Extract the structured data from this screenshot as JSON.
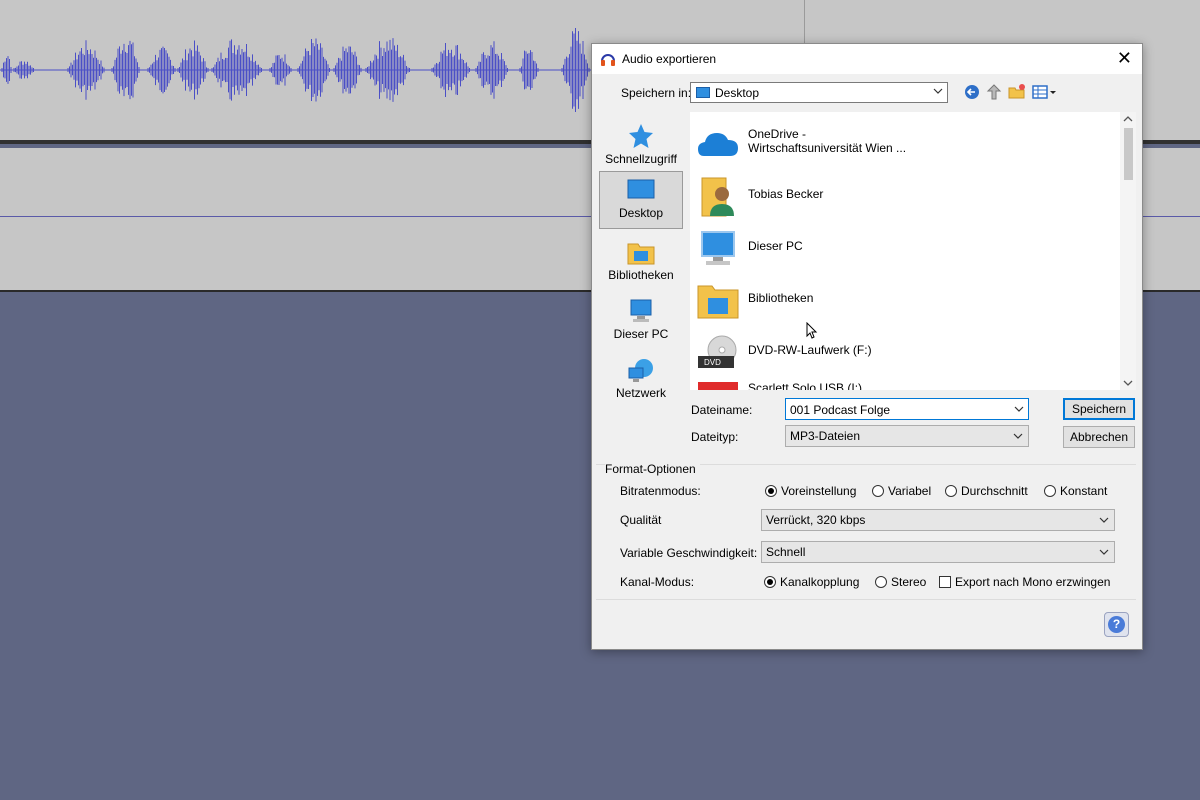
{
  "dialog": {
    "title": "Audio exportieren",
    "save_in_label": "Speichern in:",
    "save_in_value": "Desktop",
    "places": [
      {
        "label": "Schnellzugriff",
        "icon": "star-icon"
      },
      {
        "label": "Desktop",
        "icon": "desktop-icon"
      },
      {
        "label": "Bibliotheken",
        "icon": "library-icon"
      },
      {
        "label": "Dieser PC",
        "icon": "computer-icon"
      },
      {
        "label": "Netzwerk",
        "icon": "network-icon"
      }
    ],
    "files": [
      {
        "name_line1": "OneDrive -",
        "name_line2": "Wirtschaftsuniversität Wien ...",
        "icon": "onedrive-cloud-icon"
      },
      {
        "name_line1": "Tobias Becker",
        "icon": "user-folder-icon"
      },
      {
        "name_line1": "Dieser PC",
        "icon": "computer-icon"
      },
      {
        "name_line1": "Bibliotheken",
        "icon": "folder-icon"
      },
      {
        "name_line1": "DVD-RW-Laufwerk (F:)",
        "icon": "dvd-drive-icon"
      },
      {
        "name_line1": "Scarlett Solo USB (I:)",
        "icon": "usb-drive-icon"
      }
    ],
    "filename_label": "Dateiname:",
    "filename_value": "001 Podcast Folge",
    "filetype_label": "Dateityp:",
    "filetype_value": "MP3-Dateien",
    "save_button": "Speichern",
    "cancel_button": "Abbrechen",
    "format_options_title": "Format-Optionen",
    "bitrate_label": "Bitratenmodus:",
    "bitrate_options": [
      "Voreinstellung",
      "Variabel",
      "Durchschnitt",
      "Konstant"
    ],
    "quality_label": "Qualität",
    "quality_value": "Verrückt, 320 kbps",
    "speed_label": "Variable Geschwindigkeit:",
    "speed_value": "Schnell",
    "channel_label": "Kanal-Modus:",
    "channel_options": [
      "Kanalkopplung",
      "Stereo"
    ],
    "mono_checkbox": "Export nach Mono erzwingen",
    "help_glyph": "?",
    "close_glyph": "✕"
  },
  "colors": {
    "waveform": "#4b4fc6",
    "background": "#5f6683",
    "track": "#c6c6c6",
    "accent": "#0078d7"
  }
}
